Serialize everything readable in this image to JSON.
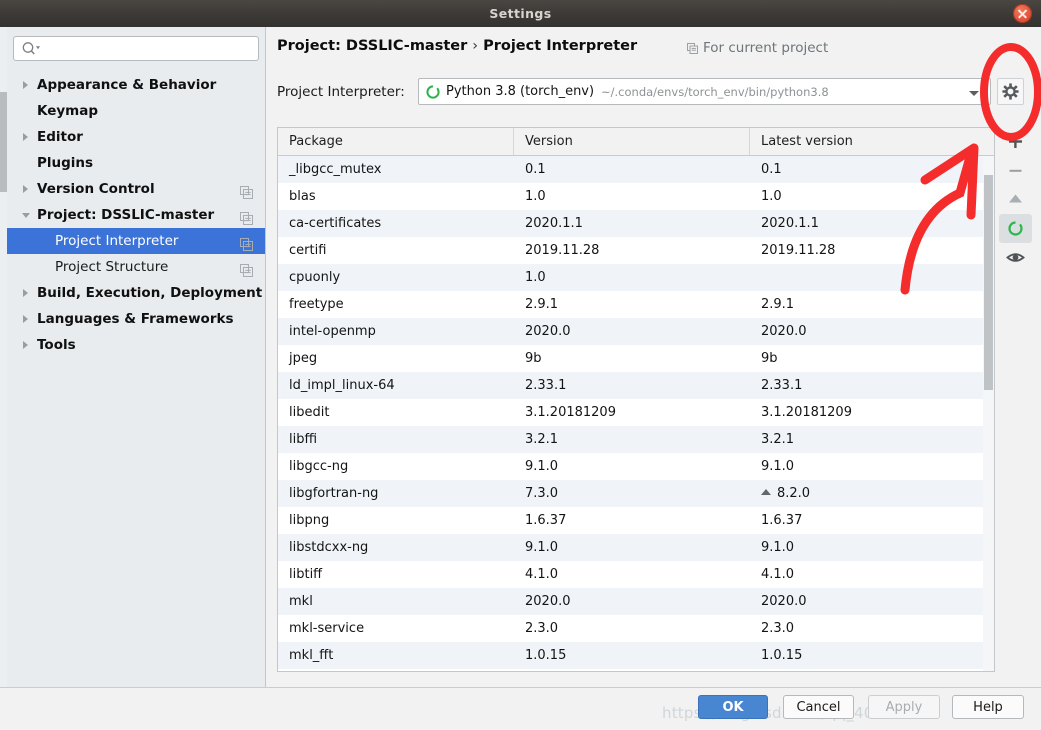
{
  "window": {
    "title": "Settings",
    "close_icon": "close-icon"
  },
  "sidebar": {
    "search": {
      "value": "",
      "placeholder": "",
      "icon": "search-icon"
    },
    "items": [
      {
        "label": "Appearance & Behavior",
        "level": 0,
        "arrow": "collapsed",
        "copy": false,
        "selected": false
      },
      {
        "label": "Keymap",
        "level": 0,
        "arrow": "none",
        "copy": false,
        "selected": false
      },
      {
        "label": "Editor",
        "level": 0,
        "arrow": "collapsed",
        "copy": false,
        "selected": false
      },
      {
        "label": "Plugins",
        "level": 0,
        "arrow": "none",
        "copy": false,
        "selected": false
      },
      {
        "label": "Version Control",
        "level": 0,
        "arrow": "collapsed",
        "copy": true,
        "selected": false
      },
      {
        "label": "Project: DSSLIC-master",
        "level": 0,
        "arrow": "expanded",
        "copy": true,
        "selected": false
      },
      {
        "label": "Project Interpreter",
        "level": 1,
        "arrow": "none",
        "copy": true,
        "selected": true
      },
      {
        "label": "Project Structure",
        "level": 1,
        "arrow": "none",
        "copy": true,
        "selected": false
      },
      {
        "label": "Build, Execution, Deployment",
        "level": 0,
        "arrow": "collapsed",
        "copy": false,
        "selected": false
      },
      {
        "label": "Languages & Frameworks",
        "level": 0,
        "arrow": "collapsed",
        "copy": false,
        "selected": false
      },
      {
        "label": "Tools",
        "level": 0,
        "arrow": "collapsed",
        "copy": false,
        "selected": false
      }
    ]
  },
  "pane": {
    "breadcrumb": {
      "root": "Project: DSSLIC-master",
      "separator": "›",
      "leaf": "Project Interpreter"
    },
    "for_current_project": "For current project",
    "interpreter": {
      "label": "Project Interpreter:",
      "name": "Python 3.8 (torch_env)",
      "path": "~/.conda/envs/torch_env/bin/python3.8",
      "icon": "python-env-icon",
      "caret_icon": "chevron-down-icon"
    },
    "gear_icon": "gear-icon"
  },
  "table": {
    "columns": [
      "Package",
      "Version",
      "Latest version"
    ],
    "rows": [
      {
        "package": "_libgcc_mutex",
        "version": "0.1",
        "latest": "0.1",
        "upgrade": false
      },
      {
        "package": "blas",
        "version": "1.0",
        "latest": "1.0",
        "upgrade": false
      },
      {
        "package": "ca-certificates",
        "version": "2020.1.1",
        "latest": "2020.1.1",
        "upgrade": false
      },
      {
        "package": "certifi",
        "version": "2019.11.28",
        "latest": "2019.11.28",
        "upgrade": false
      },
      {
        "package": "cpuonly",
        "version": "1.0",
        "latest": "",
        "upgrade": false
      },
      {
        "package": "freetype",
        "version": "2.9.1",
        "latest": "2.9.1",
        "upgrade": false
      },
      {
        "package": "intel-openmp",
        "version": "2020.0",
        "latest": "2020.0",
        "upgrade": false
      },
      {
        "package": "jpeg",
        "version": "9b",
        "latest": "9b",
        "upgrade": false
      },
      {
        "package": "ld_impl_linux-64",
        "version": "2.33.1",
        "latest": "2.33.1",
        "upgrade": false
      },
      {
        "package": "libedit",
        "version": "3.1.20181209",
        "latest": "3.1.20181209",
        "upgrade": false
      },
      {
        "package": "libffi",
        "version": "3.2.1",
        "latest": "3.2.1",
        "upgrade": false
      },
      {
        "package": "libgcc-ng",
        "version": "9.1.0",
        "latest": "9.1.0",
        "upgrade": false
      },
      {
        "package": "libgfortran-ng",
        "version": "7.3.0",
        "latest": "8.2.0",
        "upgrade": true
      },
      {
        "package": "libpng",
        "version": "1.6.37",
        "latest": "1.6.37",
        "upgrade": false
      },
      {
        "package": "libstdcxx-ng",
        "version": "9.1.0",
        "latest": "9.1.0",
        "upgrade": false
      },
      {
        "package": "libtiff",
        "version": "4.1.0",
        "latest": "4.1.0",
        "upgrade": false
      },
      {
        "package": "mkl",
        "version": "2020.0",
        "latest": "2020.0",
        "upgrade": false
      },
      {
        "package": "mkl-service",
        "version": "2.3.0",
        "latest": "2.3.0",
        "upgrade": false
      },
      {
        "package": "mkl_fft",
        "version": "1.0.15",
        "latest": "1.0.15",
        "upgrade": false
      }
    ]
  },
  "package_toolbar": {
    "buttons": [
      {
        "icon": "plus-icon",
        "selected": false
      },
      {
        "icon": "minus-icon",
        "selected": false
      },
      {
        "icon": "upgrade-arrow-icon",
        "selected": false
      },
      {
        "icon": "refresh-icon",
        "selected": true
      },
      {
        "icon": "eye-icon",
        "selected": false
      }
    ]
  },
  "footer": {
    "ok": "OK",
    "cancel": "Cancel",
    "apply": "Apply",
    "help": "Help",
    "watermark": "https://blog.csdn.net/qq_40179937"
  },
  "colors": {
    "accent": "#3b73d8",
    "primary_button": "#4986d2",
    "annotation_red": "#f42c2c",
    "upgrade_green": "#22b24c"
  }
}
